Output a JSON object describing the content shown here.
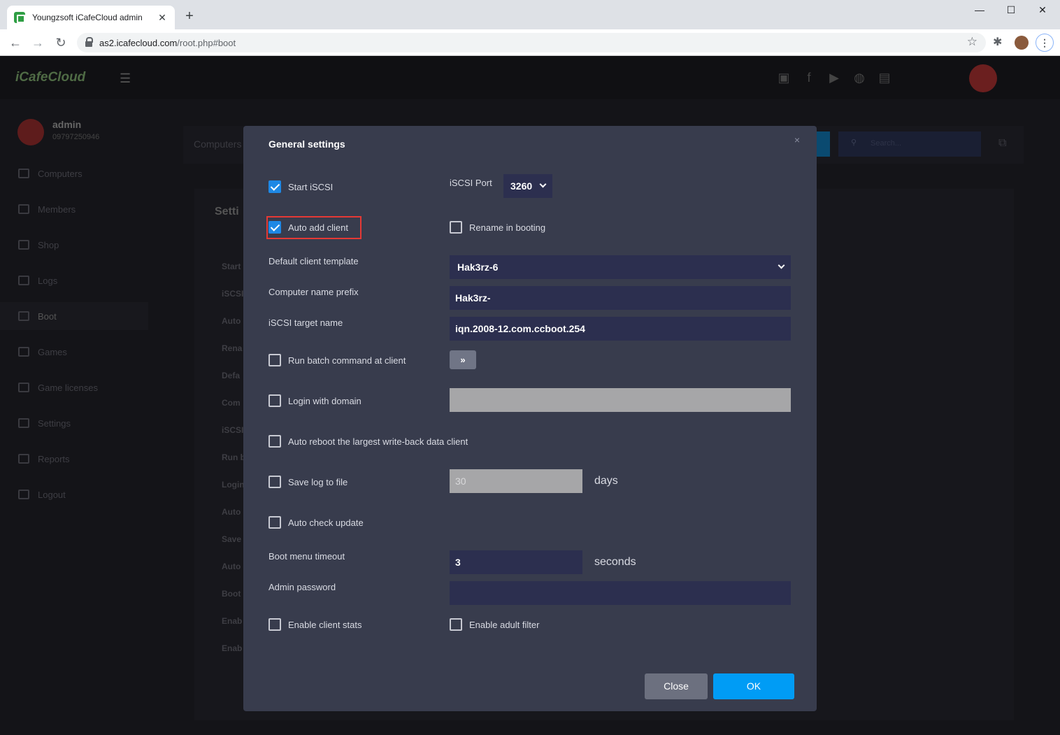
{
  "browser": {
    "tab_title": "Youngzsoft iCafeCloud admin",
    "tab_close": "✕",
    "new_tab": "+",
    "url_host": "as2.icafecloud.com",
    "url_path": "/root.php#boot",
    "minimize": "—",
    "maximize": "☐",
    "close": "✕"
  },
  "app": {
    "logo": "iCafeCloud",
    "user_name": "admin",
    "user_sub": "09797250946",
    "sidebar": [
      {
        "label": "Computers"
      },
      {
        "label": "Members"
      },
      {
        "label": "Shop"
      },
      {
        "label": "Logs"
      },
      {
        "label": "Boot"
      },
      {
        "label": "Games"
      },
      {
        "label": "Game licenses"
      },
      {
        "label": "Settings"
      },
      {
        "label": "Reports"
      },
      {
        "label": "Logout"
      }
    ],
    "breadcrumb": "Computers",
    "search_placeholder": "Search...",
    "content_title": "Setti",
    "content_labels": [
      "Start",
      "iSCSI",
      "Auto",
      "Rena",
      "Defa",
      "Com",
      "iSCSI",
      "Run b",
      "Login",
      "Auto",
      "Save",
      "Auto",
      "Boot",
      "Enab",
      "Enab"
    ]
  },
  "modal": {
    "title": "General settings",
    "close_x": "×",
    "start_iscsi": {
      "label": "Start iSCSI",
      "checked": true
    },
    "iscsi_port": {
      "label": "iSCSI Port",
      "value": "3260"
    },
    "auto_add_client": {
      "label": "Auto add client",
      "checked": true
    },
    "rename_in_booting": {
      "label": "Rename in booting",
      "checked": false
    },
    "default_client_template": {
      "label": "Default client template",
      "value": "Hak3rz-6"
    },
    "computer_name_prefix": {
      "label": "Computer name prefix",
      "value": "Hak3rz-"
    },
    "iscsi_target_name": {
      "label": "iSCSI target name",
      "value": "iqn.2008-12.com.ccboot.254"
    },
    "run_batch_command": {
      "label": "Run batch command at client",
      "checked": false,
      "button": "»"
    },
    "login_with_domain": {
      "label": "Login with domain",
      "checked": false,
      "value": ""
    },
    "auto_reboot": {
      "label": "Auto reboot the largest write-back data client",
      "checked": false
    },
    "save_log_to_file": {
      "label": "Save log to file",
      "checked": false,
      "value": "30",
      "unit": "days"
    },
    "auto_check_update": {
      "label": "Auto check update",
      "checked": false
    },
    "boot_menu_timeout": {
      "label": "Boot menu timeout",
      "value": "3",
      "unit": "seconds"
    },
    "admin_password": {
      "label": "Admin password",
      "value": ""
    },
    "enable_client_stats": {
      "label": "Enable client stats",
      "checked": false
    },
    "enable_adult_filter": {
      "label": "Enable adult filter",
      "checked": false
    },
    "close_button": "Close",
    "ok_button": "OK"
  }
}
